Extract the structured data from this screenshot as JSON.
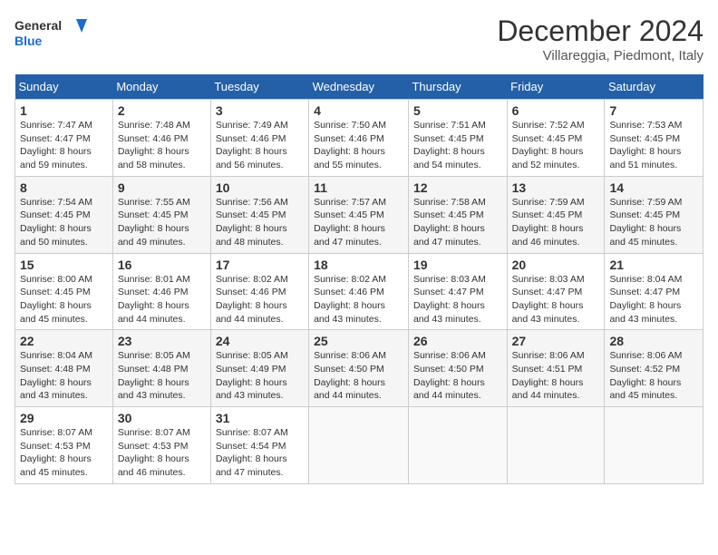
{
  "logo": {
    "line1": "General",
    "line2": "Blue"
  },
  "title": "December 2024",
  "subtitle": "Villareggia, Piedmont, Italy",
  "days_of_week": [
    "Sunday",
    "Monday",
    "Tuesday",
    "Wednesday",
    "Thursday",
    "Friday",
    "Saturday"
  ],
  "weeks": [
    [
      {
        "day": "1",
        "sunrise": "7:47 AM",
        "sunset": "4:47 PM",
        "daylight": "8 hours and 59 minutes."
      },
      {
        "day": "2",
        "sunrise": "7:48 AM",
        "sunset": "4:46 PM",
        "daylight": "8 hours and 58 minutes."
      },
      {
        "day": "3",
        "sunrise": "7:49 AM",
        "sunset": "4:46 PM",
        "daylight": "8 hours and 56 minutes."
      },
      {
        "day": "4",
        "sunrise": "7:50 AM",
        "sunset": "4:46 PM",
        "daylight": "8 hours and 55 minutes."
      },
      {
        "day": "5",
        "sunrise": "7:51 AM",
        "sunset": "4:45 PM",
        "daylight": "8 hours and 54 minutes."
      },
      {
        "day": "6",
        "sunrise": "7:52 AM",
        "sunset": "4:45 PM",
        "daylight": "8 hours and 52 minutes."
      },
      {
        "day": "7",
        "sunrise": "7:53 AM",
        "sunset": "4:45 PM",
        "daylight": "8 hours and 51 minutes."
      }
    ],
    [
      {
        "day": "8",
        "sunrise": "7:54 AM",
        "sunset": "4:45 PM",
        "daylight": "8 hours and 50 minutes."
      },
      {
        "day": "9",
        "sunrise": "7:55 AM",
        "sunset": "4:45 PM",
        "daylight": "8 hours and 49 minutes."
      },
      {
        "day": "10",
        "sunrise": "7:56 AM",
        "sunset": "4:45 PM",
        "daylight": "8 hours and 48 minutes."
      },
      {
        "day": "11",
        "sunrise": "7:57 AM",
        "sunset": "4:45 PM",
        "daylight": "8 hours and 47 minutes."
      },
      {
        "day": "12",
        "sunrise": "7:58 AM",
        "sunset": "4:45 PM",
        "daylight": "8 hours and 47 minutes."
      },
      {
        "day": "13",
        "sunrise": "7:59 AM",
        "sunset": "4:45 PM",
        "daylight": "8 hours and 46 minutes."
      },
      {
        "day": "14",
        "sunrise": "7:59 AM",
        "sunset": "4:45 PM",
        "daylight": "8 hours and 45 minutes."
      }
    ],
    [
      {
        "day": "15",
        "sunrise": "8:00 AM",
        "sunset": "4:45 PM",
        "daylight": "8 hours and 45 minutes."
      },
      {
        "day": "16",
        "sunrise": "8:01 AM",
        "sunset": "4:46 PM",
        "daylight": "8 hours and 44 minutes."
      },
      {
        "day": "17",
        "sunrise": "8:02 AM",
        "sunset": "4:46 PM",
        "daylight": "8 hours and 44 minutes."
      },
      {
        "day": "18",
        "sunrise": "8:02 AM",
        "sunset": "4:46 PM",
        "daylight": "8 hours and 43 minutes."
      },
      {
        "day": "19",
        "sunrise": "8:03 AM",
        "sunset": "4:47 PM",
        "daylight": "8 hours and 43 minutes."
      },
      {
        "day": "20",
        "sunrise": "8:03 AM",
        "sunset": "4:47 PM",
        "daylight": "8 hours and 43 minutes."
      },
      {
        "day": "21",
        "sunrise": "8:04 AM",
        "sunset": "4:47 PM",
        "daylight": "8 hours and 43 minutes."
      }
    ],
    [
      {
        "day": "22",
        "sunrise": "8:04 AM",
        "sunset": "4:48 PM",
        "daylight": "8 hours and 43 minutes."
      },
      {
        "day": "23",
        "sunrise": "8:05 AM",
        "sunset": "4:48 PM",
        "daylight": "8 hours and 43 minutes."
      },
      {
        "day": "24",
        "sunrise": "8:05 AM",
        "sunset": "4:49 PM",
        "daylight": "8 hours and 43 minutes."
      },
      {
        "day": "25",
        "sunrise": "8:06 AM",
        "sunset": "4:50 PM",
        "daylight": "8 hours and 44 minutes."
      },
      {
        "day": "26",
        "sunrise": "8:06 AM",
        "sunset": "4:50 PM",
        "daylight": "8 hours and 44 minutes."
      },
      {
        "day": "27",
        "sunrise": "8:06 AM",
        "sunset": "4:51 PM",
        "daylight": "8 hours and 44 minutes."
      },
      {
        "day": "28",
        "sunrise": "8:06 AM",
        "sunset": "4:52 PM",
        "daylight": "8 hours and 45 minutes."
      }
    ],
    [
      {
        "day": "29",
        "sunrise": "8:07 AM",
        "sunset": "4:53 PM",
        "daylight": "8 hours and 45 minutes."
      },
      {
        "day": "30",
        "sunrise": "8:07 AM",
        "sunset": "4:53 PM",
        "daylight": "8 hours and 46 minutes."
      },
      {
        "day": "31",
        "sunrise": "8:07 AM",
        "sunset": "4:54 PM",
        "daylight": "8 hours and 47 minutes."
      },
      null,
      null,
      null,
      null
    ]
  ]
}
